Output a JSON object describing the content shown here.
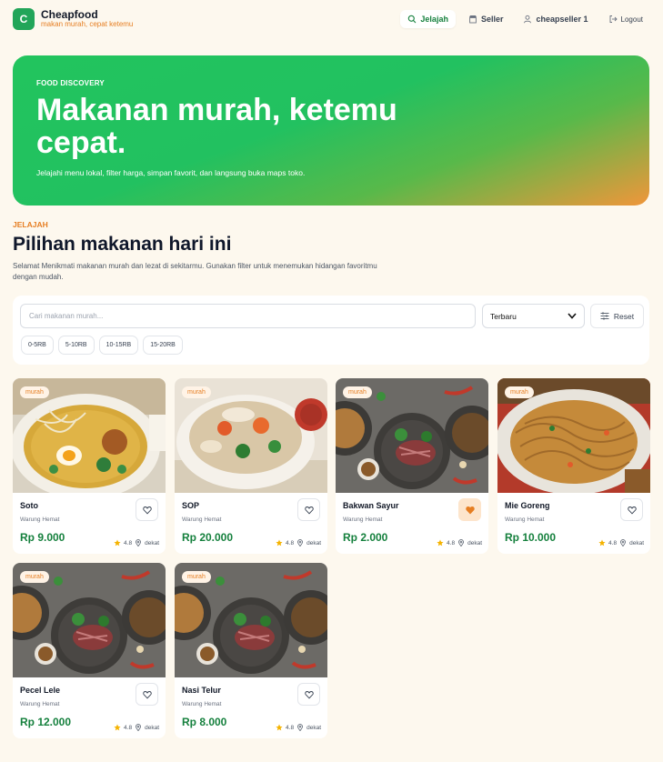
{
  "brand": {
    "logo_letter": "C",
    "name": "Cheapfood",
    "tagline": "makan murah, cepat ketemu"
  },
  "nav": {
    "explore": "Jelajah",
    "seller": "Seller",
    "user": "cheapseller 1",
    "logout": "Logout"
  },
  "hero": {
    "kicker": "FOOD DISCOVERY",
    "title": "Makanan murah, ketemu cepat.",
    "subtitle": "Jelajahi menu lokal, filter harga, simpan favorit, dan langsung buka maps toko."
  },
  "section": {
    "kicker": "JELAJAH",
    "title": "Pilihan makanan hari ini",
    "description": "Selamat Menikmati makanan murah dan lezat di sekitarmu. Gunakan filter untuk menemukan hidangan favoritmu dengan mudah."
  },
  "filters": {
    "search_placeholder": "Cari makanan murah...",
    "search_value": "",
    "sort_selected": "Terbaru",
    "reset_label": "Reset",
    "chips": [
      "0-5RB",
      "5-10RB",
      "10-15RB",
      "15-20RB"
    ]
  },
  "colors": {
    "accent_green": "#15803d",
    "accent_orange": "#e67e22",
    "background": "#fdf8ee"
  },
  "cards": [
    {
      "name": "Soto",
      "shop": "Warung Hemat",
      "price": "Rp 9.000",
      "badge": "murah",
      "rating": "4.8",
      "distance": "dekat",
      "favorite": false,
      "image": "soto"
    },
    {
      "name": "SOP",
      "shop": "Warung Hemat",
      "price": "Rp 20.000",
      "badge": "murah",
      "rating": "4.8",
      "distance": "dekat",
      "favorite": false,
      "image": "sop"
    },
    {
      "name": "Bakwan Sayur",
      "shop": "Warung Hemat",
      "price": "Rp 2.000",
      "badge": "murah",
      "rating": "4.8",
      "distance": "dekat",
      "favorite": true,
      "image": "platter"
    },
    {
      "name": "Mie Goreng",
      "shop": "Warung Hemat",
      "price": "Rp 10.000",
      "badge": "murah",
      "rating": "4.8",
      "distance": "dekat",
      "favorite": false,
      "image": "noodles"
    },
    {
      "name": "Pecel Lele",
      "shop": "Warung Hemat",
      "price": "Rp 12.000",
      "badge": "murah",
      "rating": "4.8",
      "distance": "dekat",
      "favorite": false,
      "image": "platter"
    },
    {
      "name": "Nasi Telur",
      "shop": "Warung Hemat",
      "price": "Rp 8.000",
      "badge": "murah",
      "rating": "4.8",
      "distance": "dekat",
      "favorite": false,
      "image": "platter"
    }
  ]
}
